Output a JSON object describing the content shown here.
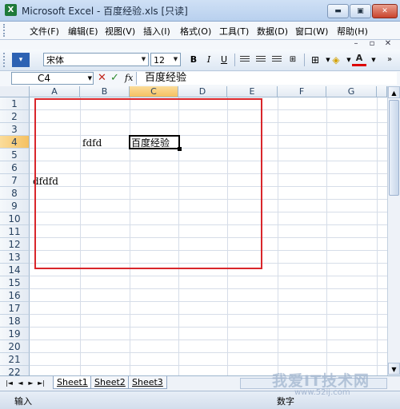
{
  "window": {
    "title": "Microsoft Excel - 百度经验.xls  [只读]",
    "min_label": "▬",
    "max_label": "▣",
    "close_label": "✕"
  },
  "menu": {
    "items": [
      "文件(F)",
      "编辑(E)",
      "视图(V)",
      "插入(I)",
      "格式(O)",
      "工具(T)",
      "数据(D)",
      "窗口(W)",
      "帮助(H)"
    ],
    "doc_min": "–",
    "doc_restore": "▫",
    "doc_close": "✕"
  },
  "toolbar": {
    "font": "宋体",
    "size": "12",
    "bold": "B",
    "italic": "I",
    "underline": "U",
    "font_color_label": "A"
  },
  "formula": {
    "name_box": "C4",
    "cancel": "✕",
    "enter": "✓",
    "fx": "fx",
    "content": "百度经验"
  },
  "grid": {
    "columns": [
      "A",
      "B",
      "C",
      "D",
      "E",
      "F",
      "G"
    ],
    "active_column": "C",
    "rows": [
      "1",
      "2",
      "3",
      "4",
      "5",
      "6",
      "7",
      "8",
      "9",
      "10",
      "11",
      "12",
      "13",
      "14",
      "15",
      "16",
      "17",
      "18",
      "19",
      "20",
      "21",
      "22"
    ],
    "active_row": "4",
    "cells": {
      "B4": "fdfd",
      "C4": "百度经验",
      "A7": "dfdfd"
    }
  },
  "sheets": {
    "tabs": [
      "Sheet1",
      "Sheet2",
      "Sheet3"
    ],
    "active": "Sheet1"
  },
  "status": {
    "mode": "输入",
    "indicator": "数字"
  },
  "watermark": {
    "text": "我爱IT技术网",
    "url": "www.52ij.com"
  },
  "colors": {
    "selection_box": "#d9262b",
    "active_header": "#f5c162",
    "title_bar": "#b8d0ee"
  }
}
